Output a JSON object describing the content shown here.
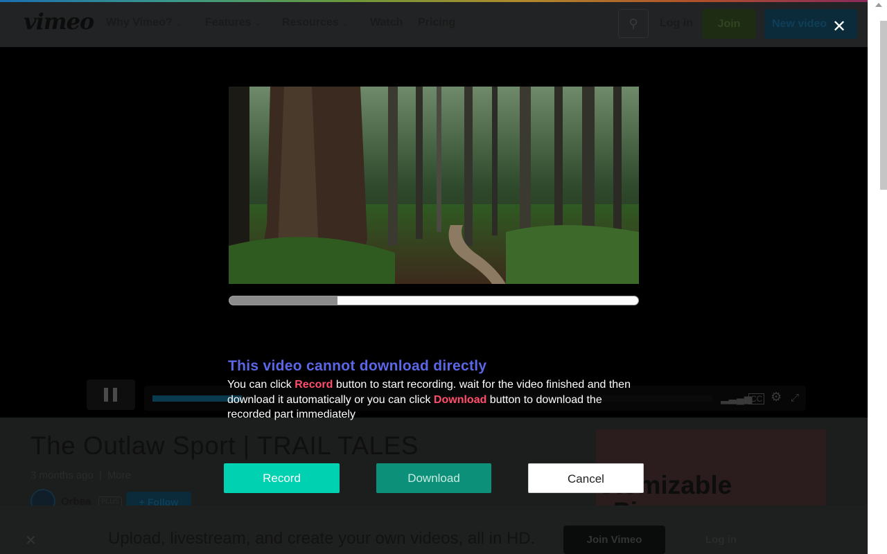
{
  "site": {
    "logo": "vimeo",
    "nav": [
      {
        "label": "Why Vimeo?",
        "has_menu": true
      },
      {
        "label": "Features",
        "has_menu": true
      },
      {
        "label": "Resources",
        "has_menu": true
      },
      {
        "label": "Watch",
        "has_menu": false
      },
      {
        "label": "Pricing",
        "has_menu": false
      }
    ],
    "login": "Log in",
    "join": "Join",
    "new_video": "New video"
  },
  "player": {
    "played_fraction": 0.16
  },
  "video": {
    "title": "The Outlaw Sport | TRAIL TALES",
    "age": "3 months ago",
    "more": "More",
    "channel": "Orbea",
    "channel_badge": "PLUS",
    "follow": "+ Follow"
  },
  "ad": {
    "line1": "stomizable",
    "line2": "Pi"
  },
  "banner": {
    "text": "Upload, livestream, and create your own videos, all in HD.",
    "join": "Join Vimeo",
    "login": "Log in"
  },
  "dialog": {
    "heading": "This video cannot download directly",
    "body_1": "You can click ",
    "record_word": "Record",
    "body_2": " button to start recording. wait for the video finished and then download it automatically or you can click ",
    "download_word": "Download",
    "body_3": " button to download the recorded part immediately",
    "recording_progress": 0.265,
    "buttons": {
      "record": "Record",
      "download": "Download",
      "cancel": "Cancel"
    },
    "close_symbol": "✕"
  },
  "colors": {
    "heading": "#5b67e6",
    "highlight": "#ff4d6a",
    "record_button": "#00d1b0",
    "download_button": "#0d9079"
  }
}
